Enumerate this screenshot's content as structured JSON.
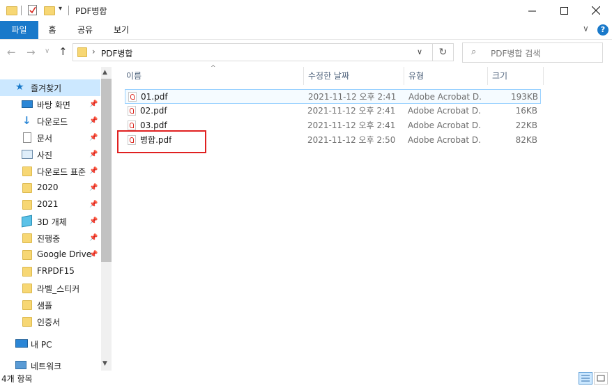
{
  "window": {
    "title": "PDF병합"
  },
  "ribbon": {
    "tabs": [
      "파일",
      "홈",
      "공유",
      "보기"
    ]
  },
  "address": {
    "path": "PDF병합",
    "search_placeholder": "PDF병합 검색"
  },
  "nav": {
    "quick_access": "즐겨찾기",
    "items": [
      {
        "label": "바탕 화면",
        "icon": "desktop-icon",
        "pinned": true
      },
      {
        "label": "다운로드",
        "icon": "download-icon",
        "pinned": true
      },
      {
        "label": "문서",
        "icon": "document-icon",
        "pinned": true
      },
      {
        "label": "사진",
        "icon": "picture-icon",
        "pinned": true
      },
      {
        "label": "다운로드 표준",
        "icon": "folder-icon",
        "pinned": true
      },
      {
        "label": "2020",
        "icon": "folder-icon",
        "pinned": true
      },
      {
        "label": "2021",
        "icon": "folder-icon",
        "pinned": true
      },
      {
        "label": "3D 개체",
        "icon": "3d-objects-icon",
        "pinned": true
      },
      {
        "label": "진행중",
        "icon": "folder-icon",
        "pinned": true
      },
      {
        "label": "Google Drive",
        "icon": "folder-icon",
        "pinned": true
      },
      {
        "label": "FRPDF15",
        "icon": "folder-icon",
        "pinned": false
      },
      {
        "label": "라벨_스티커",
        "icon": "folder-icon",
        "pinned": false
      },
      {
        "label": "샘플",
        "icon": "folder-icon",
        "pinned": false
      },
      {
        "label": "인증서",
        "icon": "folder-icon",
        "pinned": false
      }
    ],
    "this_pc": "내 PC",
    "network": "네트워크"
  },
  "columns": {
    "name": "이름",
    "modified": "수정한 날짜",
    "type": "유형",
    "size": "크기"
  },
  "files": [
    {
      "name": "01.pdf",
      "modified": "2021-11-12 오후 2:41",
      "type": "Adobe Acrobat D...",
      "size": "193KB"
    },
    {
      "name": "02.pdf",
      "modified": "2021-11-12 오후 2:41",
      "type": "Adobe Acrobat D...",
      "size": "16KB"
    },
    {
      "name": "03.pdf",
      "modified": "2021-11-12 오후 2:41",
      "type": "Adobe Acrobat D...",
      "size": "22KB"
    },
    {
      "name": "병합.pdf",
      "modified": "2021-11-12 오후 2:50",
      "type": "Adobe Acrobat D...",
      "size": "82KB"
    }
  ],
  "status": {
    "item_count": "4개 항목"
  },
  "colors": {
    "accent": "#1979ca",
    "selection": "#cce8ff",
    "highlight_box": "#e02020"
  }
}
